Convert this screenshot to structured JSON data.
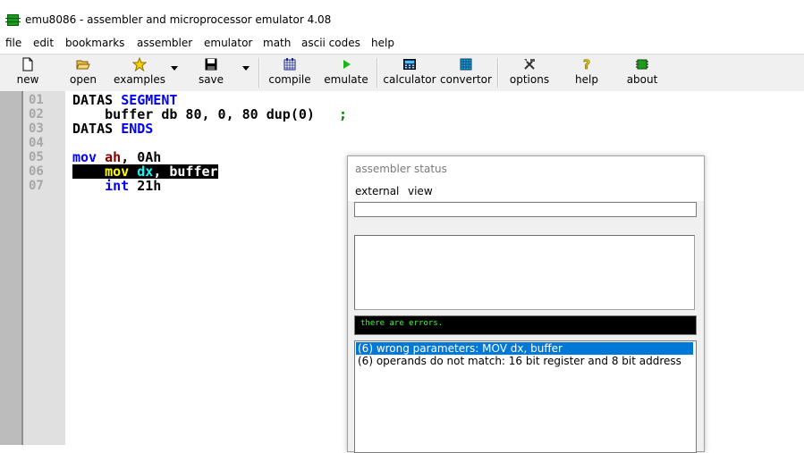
{
  "window": {
    "title": "emu8086 - assembler and microprocessor emulator 4.08"
  },
  "menu": [
    "file",
    "edit",
    "bookmarks",
    "assembler",
    "emulator",
    "math",
    "ascii codes",
    "help"
  ],
  "toolbar": {
    "new": "new",
    "open": "open",
    "examples": "examples",
    "save": "save",
    "compile": "compile",
    "emulate": "emulate",
    "calculator": "calculator",
    "convertor": "convertor",
    "options": "options",
    "help": "help",
    "about": "about"
  },
  "editor": {
    "line_numbers": [
      "01",
      "02",
      "03",
      "04",
      "05",
      "06",
      "07"
    ],
    "lines": [
      {
        "tokens": [
          {
            "text": "DATAS ",
            "color": "#000000"
          },
          {
            "text": "SEGMENT",
            "color": "#0000ff"
          }
        ]
      },
      {
        "tokens": [
          {
            "text": "    buffer db 80, 0, 80 dup(0)  ",
            "color": "#000000"
          },
          {
            "text": " ;",
            "color": "#008000"
          }
        ]
      },
      {
        "tokens": [
          {
            "text": "DATAS ",
            "color": "#000000"
          },
          {
            "text": "ENDS",
            "color": "#0000ff"
          }
        ]
      },
      {
        "tokens": []
      },
      {
        "tokens": [
          {
            "text": "mov ",
            "color": "#0000ff"
          },
          {
            "text": "ah",
            "color": "#800000"
          },
          {
            "text": ", 0Ah",
            "color": "#000000"
          }
        ]
      },
      {
        "selected": true,
        "tokens": [
          {
            "text": "    mov ",
            "color": "#ffff00"
          },
          {
            "text": "dx",
            "color": "#00ffff"
          },
          {
            "text": ", buffer",
            "color": "#ffffff"
          }
        ]
      },
      {
        "tokens": [
          {
            "text": "    int ",
            "color": "#0000ff"
          },
          {
            "text": "21h",
            "color": "#000000"
          }
        ]
      }
    ]
  },
  "dialog": {
    "title": "assembler status",
    "menu": {
      "external": "external",
      "view": "view"
    },
    "input_value": "",
    "status_text": "there are errors.",
    "errors": [
      "(6) wrong parameters: MOV  dx, buffer",
      "(6) operands do not match: 16 bit register and 8 bit address"
    ]
  },
  "colors": {
    "accent_selection": "#0078d7",
    "status_bg": "#000000",
    "status_fg": "#34ff34"
  }
}
